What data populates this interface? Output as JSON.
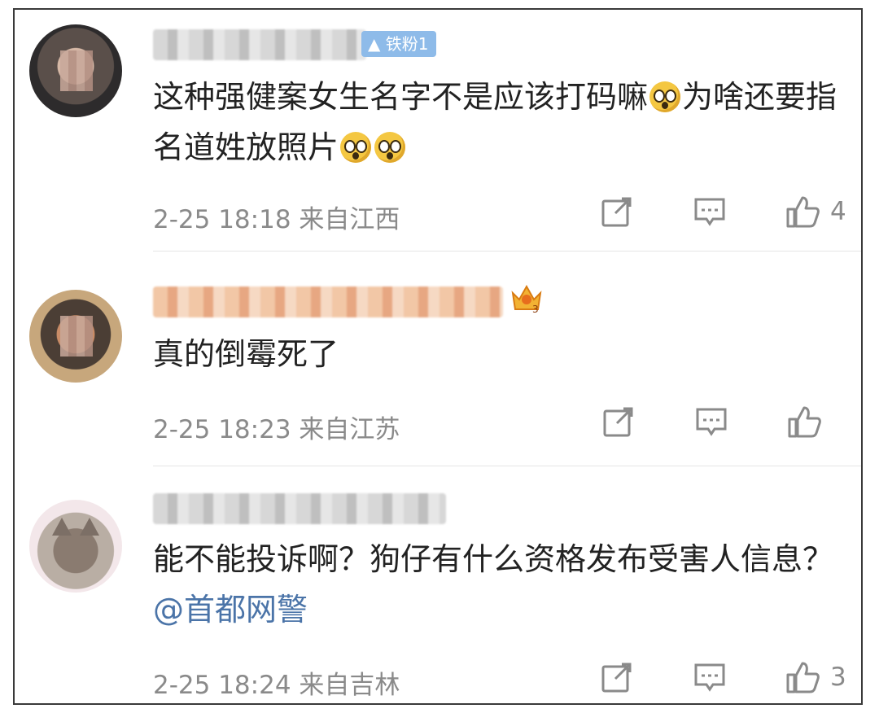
{
  "comments": [
    {
      "badge": "铁粉1",
      "text_parts": [
        "这种强健案女生名字不是应该打码嘛",
        "为啥还要指名道姓放照片"
      ],
      "time": "2-25 18:18",
      "location": "来自江西",
      "likes": "4",
      "emoji": "surprised-face-emoji"
    },
    {
      "text": "真的倒霉死了",
      "time": "2-25 18:23",
      "location": "来自江苏",
      "likes": ""
    },
    {
      "text": "能不能投诉啊？狗仔有什么资格发布受害人信息？",
      "mention": "@首都网警",
      "time": "2-25 18:24",
      "location": "来自吉林",
      "likes": "3"
    }
  ],
  "icons": {
    "share": "share-icon",
    "comment": "comment-icon",
    "like": "thumbs-up-icon",
    "crown": "crown-badge-icon"
  },
  "colors": {
    "text": "#222222",
    "meta": "#8a8a8a",
    "badge": "#8ebbe9",
    "mention": "#4b74a8"
  }
}
